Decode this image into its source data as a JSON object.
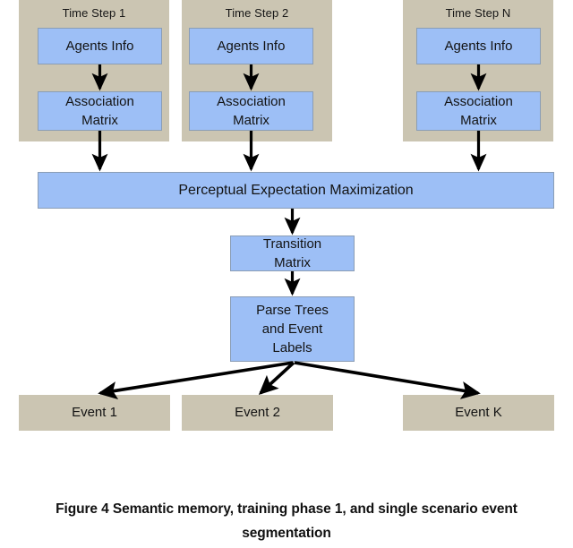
{
  "figure": {
    "caption_line1": "Figure 4 Semantic memory, training phase 1, and single scenario event",
    "caption_line2": "segmentation",
    "caption_full": "Figure 4 Semantic memory, training phase 1, and single scenario event segmentation"
  },
  "colors": {
    "panel_beige": "#cbc5b2",
    "box_blue": "#9dbff6",
    "box_blue_border": "#8a9db5",
    "arrow_black": "#000000",
    "background": "#ffffff",
    "text": "#131313"
  },
  "time_step_groups": [
    {
      "label": "Time Step 1",
      "agents_box": "Agents Info",
      "association_box_line1": "Association",
      "association_box_line2": "Matrix"
    },
    {
      "label": "Time Step 2",
      "agents_box": "Agents Info",
      "association_box_line1": "Association",
      "association_box_line2": "Matrix"
    },
    {
      "label": "Time Step N",
      "agents_box": "Agents Info",
      "association_box_line1": "Association",
      "association_box_line2": "Matrix"
    }
  ],
  "pipeline": {
    "pem_bar": "Perceptual Expectation Maximization",
    "transition_matrix_line1": "Transition",
    "transition_matrix_line2": "Matrix",
    "parse_trees_line1": "Parse Trees",
    "parse_trees_line2": "and Event",
    "parse_trees_line3": "Labels"
  },
  "events": [
    {
      "label": "Event 1"
    },
    {
      "label": "Event 2"
    },
    {
      "label": "Event K"
    }
  ],
  "arrows": {
    "agents_to_association": "downward arrow",
    "association_to_pem": "downward arrow",
    "pem_to_transition": "downward arrow",
    "transition_to_parse": "downward arrow",
    "parse_to_events": "fan-out arrows"
  }
}
